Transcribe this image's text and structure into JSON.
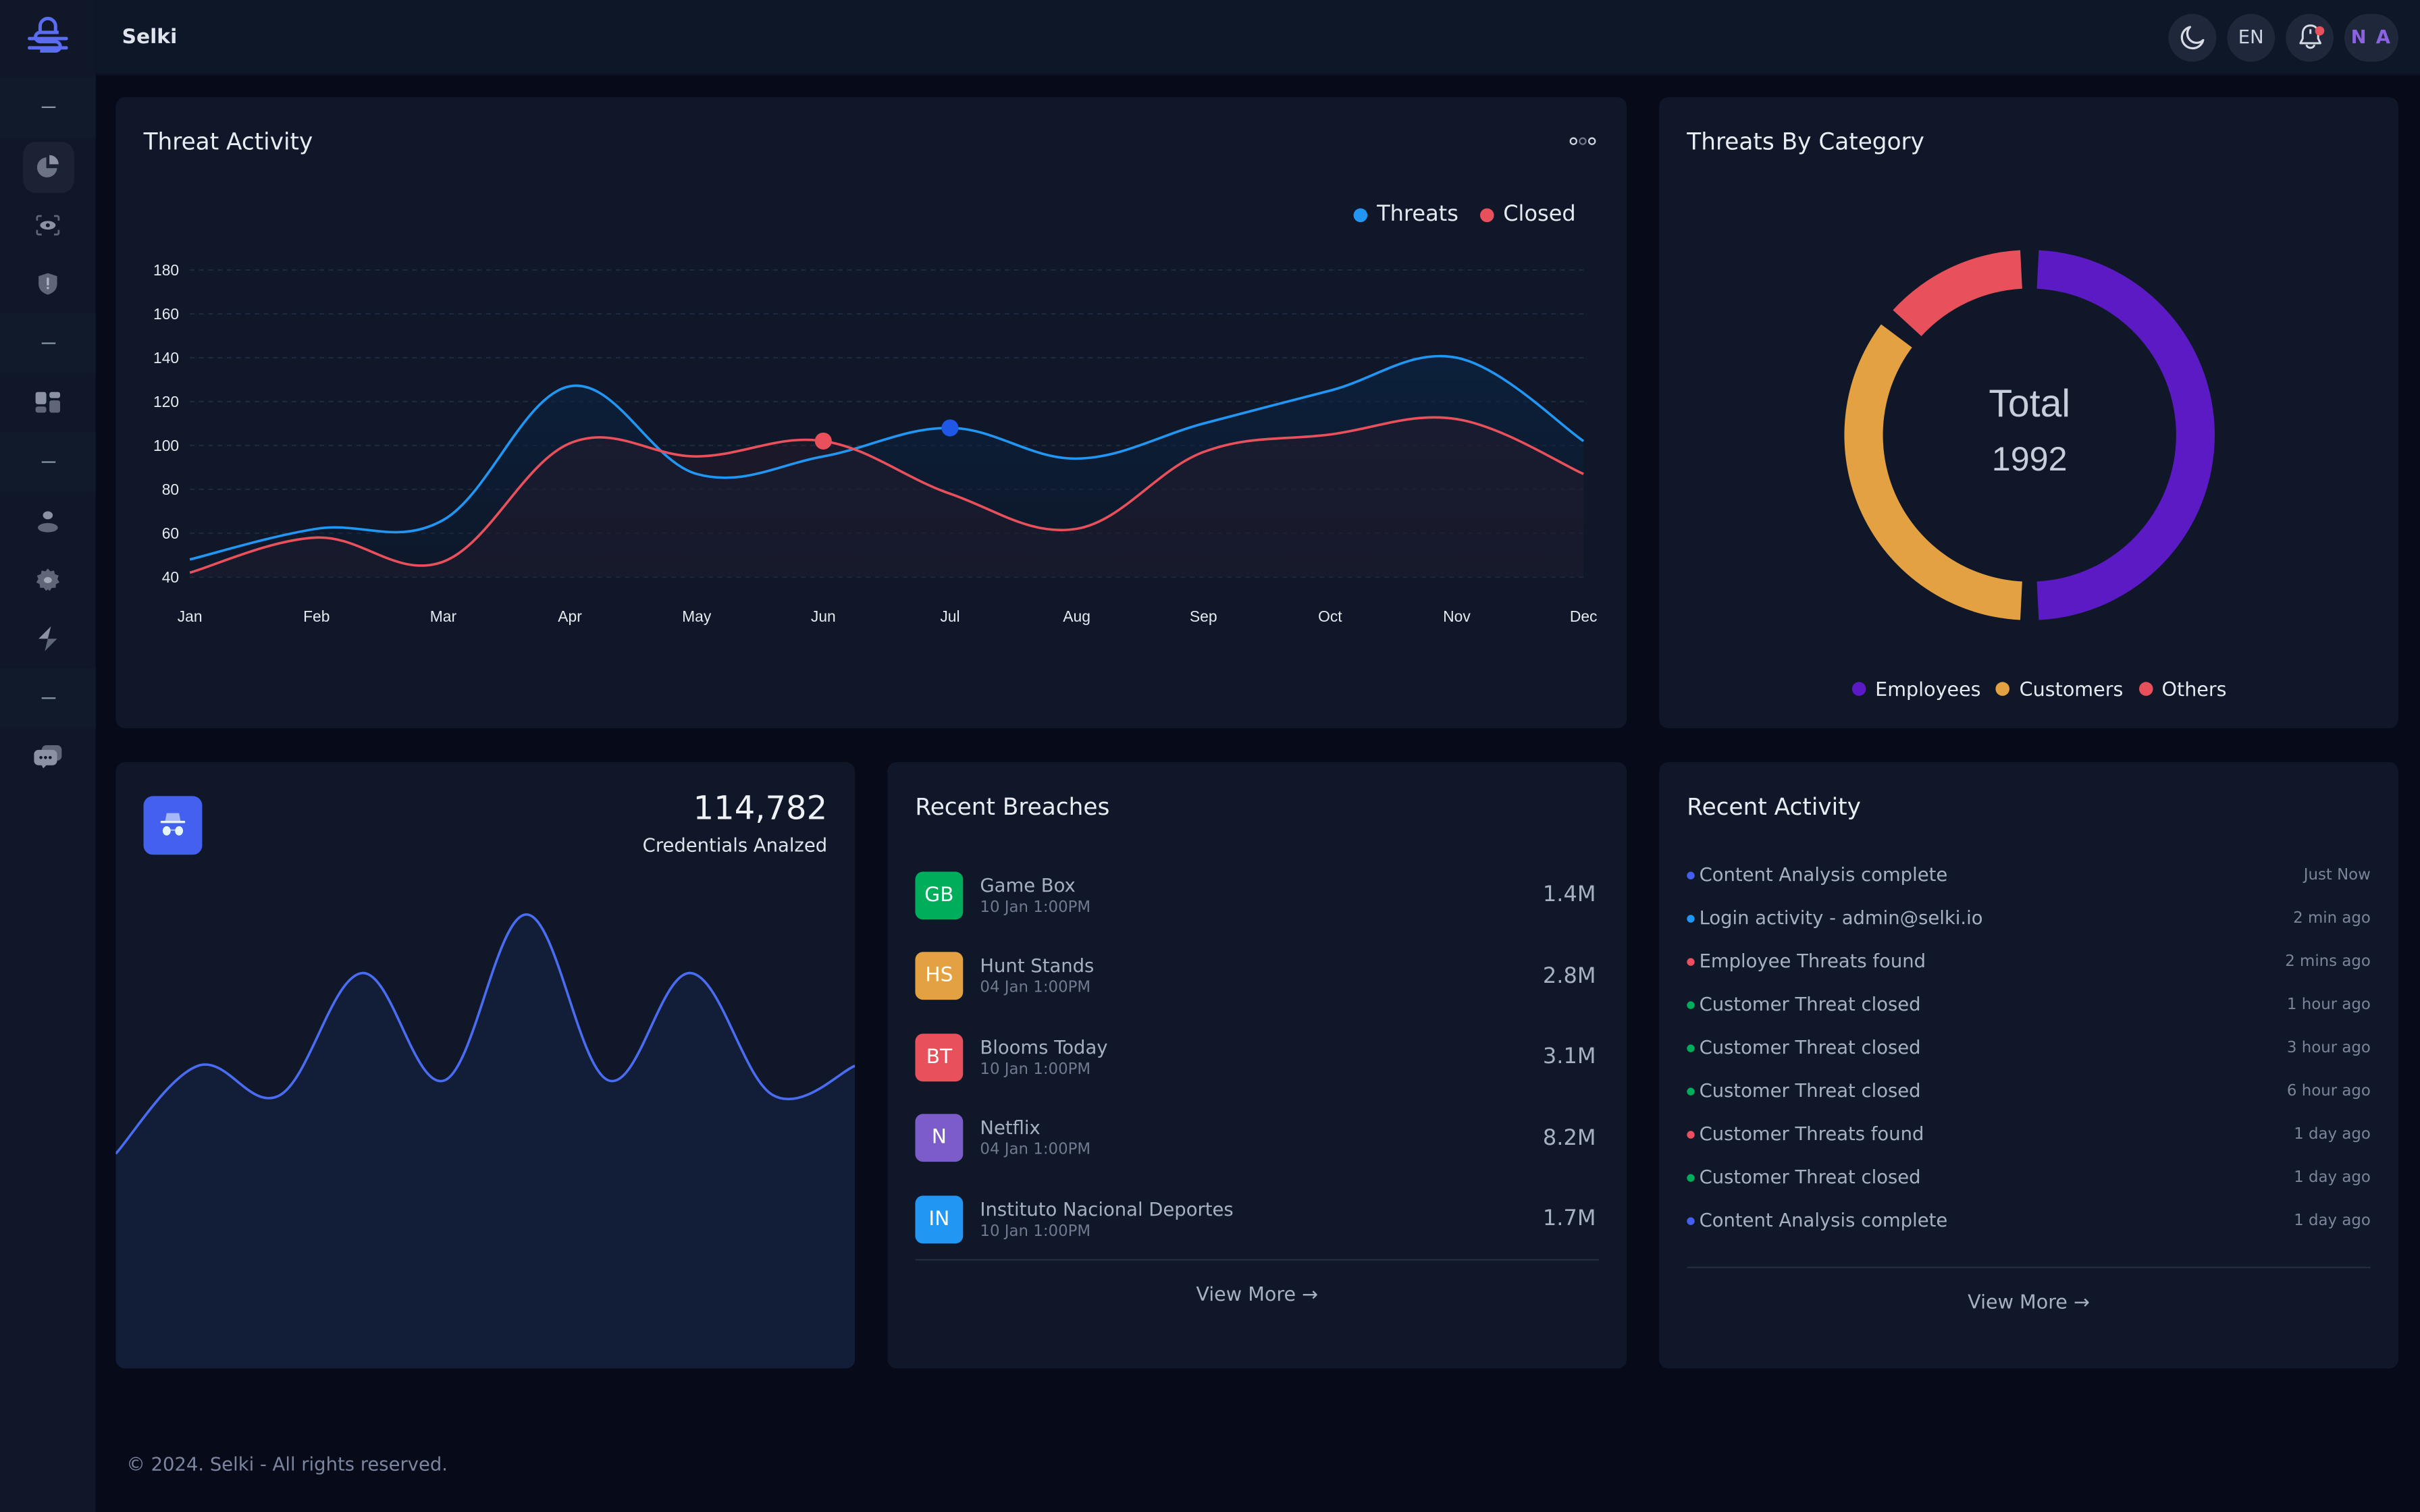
{
  "app": {
    "title": "Selki"
  },
  "header": {
    "theme_toggle": "moon-icon",
    "language": "EN",
    "notifications_icon": "bell-icon",
    "user_initials": "N A"
  },
  "sidebar": {
    "items": [
      {
        "icon": "separator"
      },
      {
        "icon": "pie-chart-icon",
        "active": true
      },
      {
        "icon": "eye-scan-icon"
      },
      {
        "icon": "shield-alert-icon"
      },
      {
        "icon": "separator"
      },
      {
        "icon": "dashboard-grid-icon"
      },
      {
        "icon": "separator"
      },
      {
        "icon": "user-icon"
      },
      {
        "icon": "settings-gear-icon"
      },
      {
        "icon": "lightning-icon"
      },
      {
        "icon": "separator"
      },
      {
        "icon": "chat-bubbles-icon"
      }
    ]
  },
  "threat_activity": {
    "title": "Threat Activity",
    "menu_icon": "more-options-icon"
  },
  "threats_by_category": {
    "title": "Threats By Category",
    "center_label": "Total",
    "center_value": "1992"
  },
  "credentials": {
    "icon": "incognito-icon",
    "value": "114,782",
    "label": "Credentials Analzed",
    "sparkline": [
      44,
      62,
      56,
      81,
      59,
      93,
      59,
      81,
      56,
      62
    ]
  },
  "recent_breaches": {
    "title": "Recent Breaches",
    "items": [
      {
        "initials": "GB",
        "name": "Game Box",
        "date": "10 Jan 1:00PM",
        "value": "1.4M",
        "color": "#00ad5b"
      },
      {
        "initials": "HS",
        "name": "Hunt Stands",
        "date": "04 Jan 1:00PM",
        "value": "2.8M",
        "color": "#e3a141"
      },
      {
        "initials": "BT",
        "name": "Blooms Today",
        "date": "10 Jan 1:00PM",
        "value": "3.1M",
        "color": "#e8505b"
      },
      {
        "initials": "N",
        "name": "Netflix",
        "date": "04 Jan 1:00PM",
        "value": "8.2M",
        "color": "#7b5cc8"
      },
      {
        "initials": "IN",
        "name": "Instituto Nacional Deportes",
        "date": "10 Jan 1:00PM",
        "value": "1.7M",
        "color": "#2196f3"
      }
    ],
    "view_more": "View More →"
  },
  "recent_activity": {
    "title": "Recent Activity",
    "items": [
      {
        "text": "Content Analysis complete",
        "time": "Just Now",
        "color": "#4361ee"
      },
      {
        "text": "Login activity - admin@selki.io",
        "time": "2 min ago",
        "color": "#2196f3"
      },
      {
        "text": "Employee Threats found",
        "time": "2 mins ago",
        "color": "#e8505b"
      },
      {
        "text": "Customer Threat closed",
        "time": "1 hour ago",
        "color": "#00ad5b"
      },
      {
        "text": "Customer Threat closed",
        "time": "3 hour ago",
        "color": "#00ad5b"
      },
      {
        "text": "Customer Threat closed",
        "time": "6 hour ago",
        "color": "#00ad5b"
      },
      {
        "text": "Customer Threats found",
        "time": "1 day ago",
        "color": "#e8505b"
      },
      {
        "text": "Customer Threat closed",
        "time": "1 day ago",
        "color": "#00ad5b"
      },
      {
        "text": "Content Analysis complete",
        "time": "1 day ago",
        "color": "#4361ee"
      }
    ],
    "view_more": "View More →"
  },
  "footer": {
    "text": "© 2024. Selki - All rights reserved."
  },
  "chart_data": [
    {
      "type": "area",
      "title": "Threat Activity",
      "categories": [
        "Jan",
        "Feb",
        "Mar",
        "Apr",
        "May",
        "Jun",
        "Jul",
        "Aug",
        "Sep",
        "Oct",
        "Nov",
        "Dec"
      ],
      "series": [
        {
          "name": "Threats",
          "color": "#2196f3",
          "values": [
            48,
            62,
            66,
            127,
            87,
            95,
            108,
            94,
            110,
            125,
            140,
            102
          ],
          "highlight_index": 6
        },
        {
          "name": "Closed",
          "color": "#e8505b",
          "values": [
            42,
            58,
            47,
            101,
            95,
            102,
            78,
            62,
            97,
            105,
            112,
            87
          ],
          "highlight_index": 5
        }
      ],
      "ylim": [
        40,
        180
      ],
      "yticks": [
        40,
        60,
        80,
        100,
        120,
        140,
        160,
        180
      ],
      "grid": true,
      "legend": "top-right",
      "xlabel": "",
      "ylabel": ""
    },
    {
      "type": "pie",
      "title": "Threats By Category",
      "donut": true,
      "total": 1992,
      "categories": [
        "Employees",
        "Customers",
        "Others"
      ],
      "values": [
        50,
        36,
        14
      ],
      "colors": [
        "#5b1ac4",
        "#e3a141",
        "#e8505b"
      ],
      "legend": "bottom"
    }
  ]
}
